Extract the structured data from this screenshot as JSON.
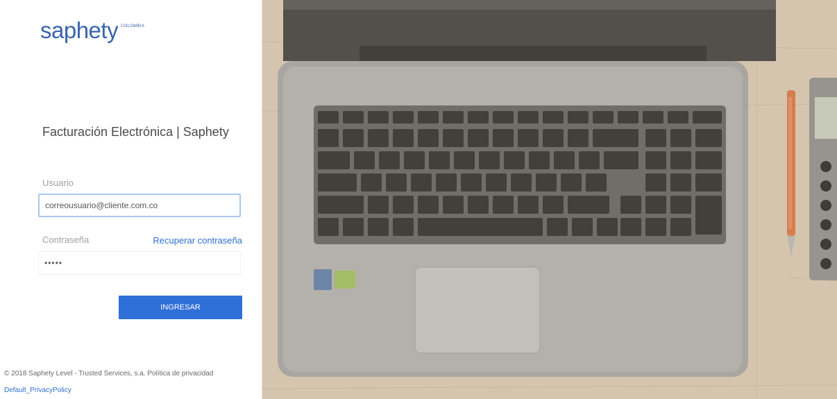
{
  "brand": {
    "logo_word": "saphety",
    "logo_sub": "COLOMBIA"
  },
  "login": {
    "title": "Facturación Electrónica | Saphety",
    "user_label": "Usuario",
    "user_value": "correousuario@cliente.com.co",
    "pass_label": "Contraseña",
    "pass_value": "•••••",
    "recover_link": "Recuperar contraseña",
    "submit_label": "INGRESAR"
  },
  "footer": {
    "copyright": "© 2018 Saphety Level - Trusted Services, s.a. Política de privacidad",
    "policy_link": "Default_PrivacyPolicy"
  },
  "hero_image": {
    "depicts": "laptop-keyboard-on-desk"
  },
  "colors": {
    "brand_blue": "#3a64ad",
    "button_blue": "#2f6fd8",
    "link_blue": "#2f6fd0"
  }
}
